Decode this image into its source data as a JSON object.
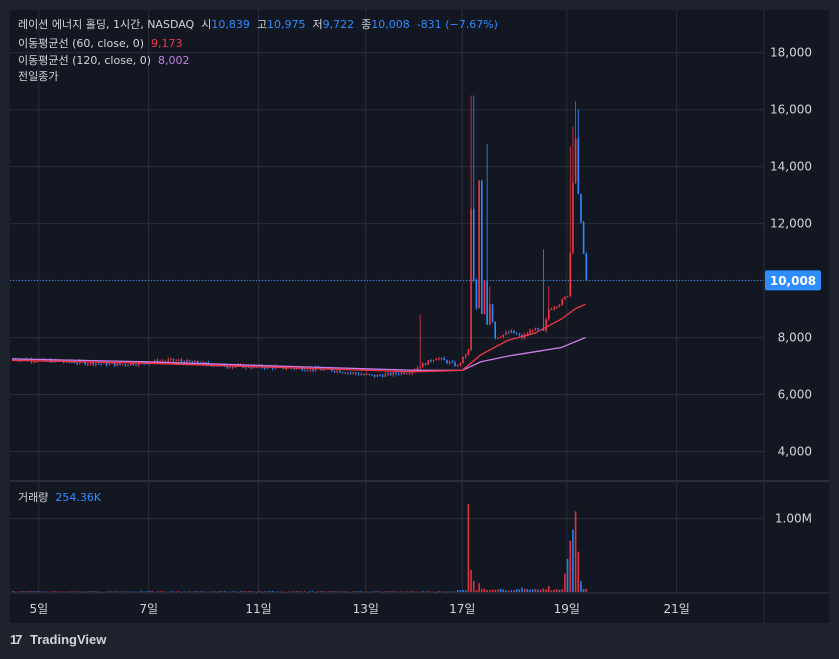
{
  "header": {
    "name": "레이션 에너지 홀딩",
    "interval": "1시간",
    "exchange": "NASDAQ",
    "open_label": "시",
    "open_value": "10,839",
    "high_label": "고",
    "high_value": "10,975",
    "low_label": "저",
    "low_value": "9,722",
    "close_label": "종",
    "close_value": "10,008",
    "change": "-831",
    "change_pct": "(−7.67%)"
  },
  "indicators": [
    {
      "label": "이동평균선 (60, close, 0)",
      "value": "9,173",
      "color": "#f23645"
    },
    {
      "label": "이동평균선 (120, close, 0)",
      "value": "8,002",
      "color": "#c77ee8"
    },
    {
      "label": "전일종가",
      "value": ""
    }
  ],
  "volume": {
    "label": "거래량",
    "value": "254.36K"
  },
  "price_axis": {
    "ticks": [
      "18,000",
      "16,000",
      "14,000",
      "12,000",
      "10,000",
      "8,000",
      "6,000",
      "4,000"
    ],
    "last_price_label": "10,008"
  },
  "volume_axis": {
    "ticks": [
      "1.00M"
    ]
  },
  "time_axis": {
    "ticks": [
      "5일",
      "7일",
      "11일",
      "13일",
      "17일",
      "19일",
      "21일"
    ]
  },
  "colors": {
    "up": "#f23645",
    "down": "#2e8cff",
    "background": "#1e222d",
    "pane": "#131722",
    "grid": "#2a2e39"
  },
  "footer": {
    "brand": "TradingView"
  },
  "chart_data": {
    "type": "candlestick",
    "interval": "1h",
    "price_ylim": [
      3000,
      19500
    ],
    "volume_ylim": [
      0,
      1500000
    ],
    "last_price": 10008,
    "x_ticks": [
      "5일",
      "7일",
      "11일",
      "13일",
      "17일",
      "19일",
      "21일"
    ],
    "anchors": [
      {
        "i": 0,
        "p": 7250
      },
      {
        "i": 20,
        "p": 7150
      },
      {
        "i": 40,
        "p": 7050
      },
      {
        "i": 60,
        "p": 7200
      },
      {
        "i": 80,
        "p": 7000
      },
      {
        "i": 100,
        "p": 6950
      },
      {
        "i": 120,
        "p": 6850
      },
      {
        "i": 135,
        "p": 6650
      },
      {
        "i": 148,
        "p": 6800
      },
      {
        "i": 158,
        "p": 7300
      },
      {
        "i": 166,
        "p": 7000
      },
      {
        "i": 170,
        "p": 7550
      },
      {
        "i": 171,
        "p": 12500
      },
      {
        "i": 172,
        "p": 10000
      },
      {
        "i": 173,
        "p": 9000
      },
      {
        "i": 174,
        "p": 13500
      },
      {
        "i": 175,
        "p": 8800
      },
      {
        "i": 176,
        "p": 10000
      },
      {
        "i": 177,
        "p": 8500
      },
      {
        "i": 178,
        "p": 9200
      },
      {
        "i": 180,
        "p": 8000
      },
      {
        "i": 186,
        "p": 8200
      },
      {
        "i": 190,
        "p": 8000
      },
      {
        "i": 194,
        "p": 8300
      },
      {
        "i": 198,
        "p": 8200
      },
      {
        "i": 200,
        "p": 9000
      },
      {
        "i": 204,
        "p": 9200
      },
      {
        "i": 207,
        "p": 9500
      },
      {
        "i": 208,
        "p": 11000
      },
      {
        "i": 209,
        "p": 13500
      },
      {
        "i": 210,
        "p": 15000
      },
      {
        "i": 211,
        "p": 13000
      },
      {
        "i": 212,
        "p": 12000
      },
      {
        "i": 213,
        "p": 11000
      },
      {
        "i": 214,
        "p": 10008
      }
    ],
    "spikes": [
      {
        "i": 152,
        "h": 8800
      },
      {
        "i": 171,
        "h": 16500
      },
      {
        "i": 172,
        "h": 16500
      },
      {
        "i": 174,
        "h": 11800
      },
      {
        "i": 175,
        "h": 10500
      },
      {
        "i": 177,
        "h": 14800
      },
      {
        "i": 178,
        "h": 9800
      },
      {
        "i": 198,
        "h": 11100
      },
      {
        "i": 200,
        "h": 9800
      },
      {
        "i": 208,
        "h": 14700
      },
      {
        "i": 209,
        "h": 15400
      },
      {
        "i": 210,
        "h": 16300
      },
      {
        "i": 211,
        "h": 16000
      }
    ],
    "ma60": [
      {
        "i": 0,
        "p": 7200
      },
      {
        "i": 50,
        "p": 7100
      },
      {
        "i": 100,
        "p": 6950
      },
      {
        "i": 150,
        "p": 6800
      },
      {
        "i": 168,
        "p": 6850
      },
      {
        "i": 175,
        "p": 7400
      },
      {
        "i": 185,
        "p": 7900
      },
      {
        "i": 195,
        "p": 8150
      },
      {
        "i": 200,
        "p": 8400
      },
      {
        "i": 205,
        "p": 8650
      },
      {
        "i": 210,
        "p": 9000
      },
      {
        "i": 214,
        "p": 9173
      }
    ],
    "ma120": [
      {
        "i": 0,
        "p": 7250
      },
      {
        "i": 50,
        "p": 7150
      },
      {
        "i": 100,
        "p": 7000
      },
      {
        "i": 150,
        "p": 6850
      },
      {
        "i": 168,
        "p": 6850
      },
      {
        "i": 175,
        "p": 7150
      },
      {
        "i": 185,
        "p": 7350
      },
      {
        "i": 195,
        "p": 7500
      },
      {
        "i": 205,
        "p": 7650
      },
      {
        "i": 214,
        "p": 8002
      }
    ],
    "volume_spikes": [
      {
        "i": 170,
        "v": 1200000
      },
      {
        "i": 171,
        "v": 300000
      },
      {
        "i": 172,
        "v": 150000
      },
      {
        "i": 174,
        "v": 120000
      },
      {
        "i": 190,
        "v": 60000
      },
      {
        "i": 200,
        "v": 80000
      },
      {
        "i": 206,
        "v": 250000
      },
      {
        "i": 207,
        "v": 450000
      },
      {
        "i": 208,
        "v": 700000
      },
      {
        "i": 209,
        "v": 850000
      },
      {
        "i": 210,
        "v": 1100000
      },
      {
        "i": 211,
        "v": 550000
      },
      {
        "i": 212,
        "v": 150000
      }
    ]
  }
}
